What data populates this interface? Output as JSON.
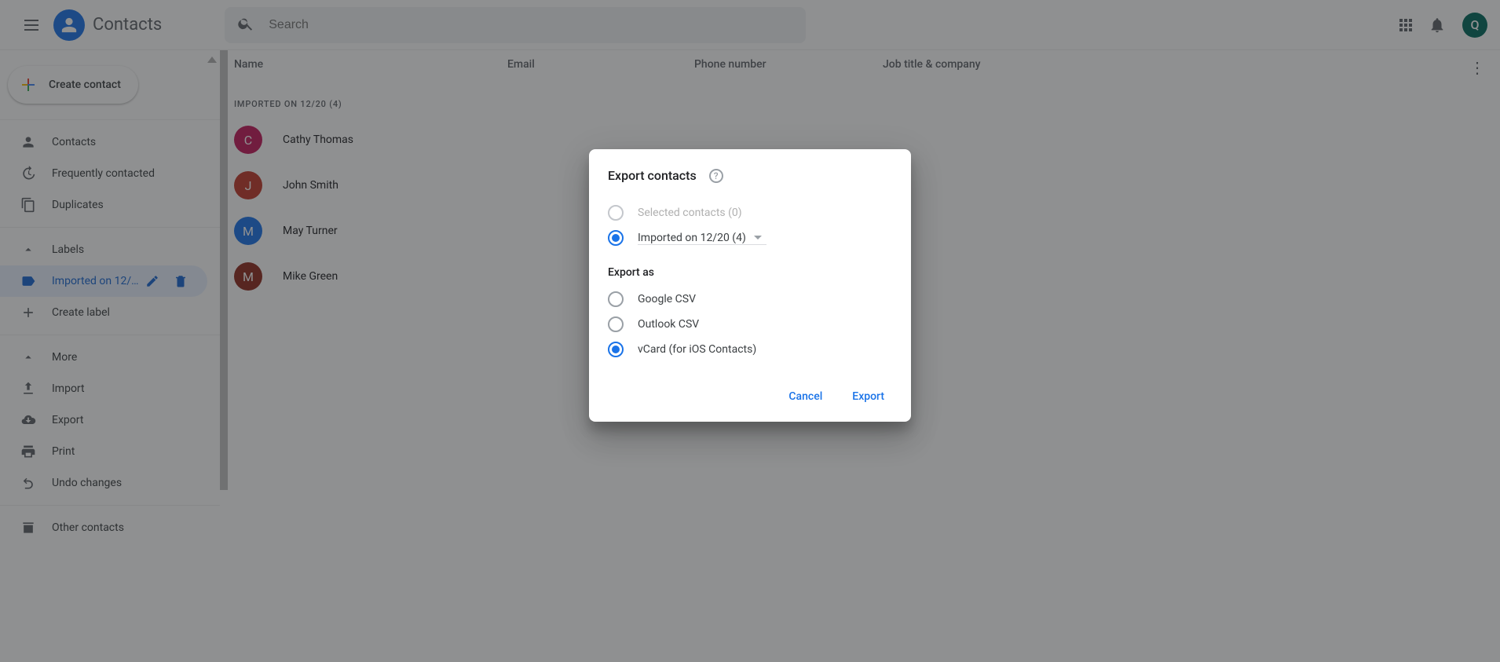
{
  "header": {
    "app_name": "Contacts",
    "search_placeholder": "Search",
    "avatar_initial": "Q"
  },
  "sidebar": {
    "create_label": "Create label",
    "nav_contacts": "Contacts",
    "nav_frequent": "Frequently contacted",
    "nav_duplicates": "Duplicates",
    "labels_header": "Labels",
    "label_imported": "Imported on 12/...",
    "more": "More",
    "import": "Import",
    "export": "Export",
    "print": "Print",
    "undo": "Undo changes",
    "other": "Other contacts",
    "create_contact_label": "Create contact"
  },
  "table": {
    "col_name": "Name",
    "col_email": "Email",
    "col_phone": "Phone number",
    "col_job": "Job title & company",
    "group_label": "IMPORTED ON 12/20 (4)",
    "rows": [
      {
        "initial": "C",
        "name": "Cathy Thomas",
        "colorClass": "c-pink"
      },
      {
        "initial": "J",
        "name": "John Smith",
        "colorClass": "c-red"
      },
      {
        "initial": "M",
        "name": "May Turner",
        "colorClass": "c-blue"
      },
      {
        "initial": "M",
        "name": "Mike Green",
        "colorClass": "c-dred"
      }
    ]
  },
  "dialog": {
    "title": "Export contacts",
    "opt_selected": "Selected contacts (0)",
    "opt_imported": "Imported on 12/20 (4)",
    "section_export_as": "Export as",
    "opt_gcsv": "Google CSV",
    "opt_ocsv": "Outlook CSV",
    "opt_vcard": "vCard (for iOS Contacts)",
    "cancel": "Cancel",
    "export": "Export"
  }
}
